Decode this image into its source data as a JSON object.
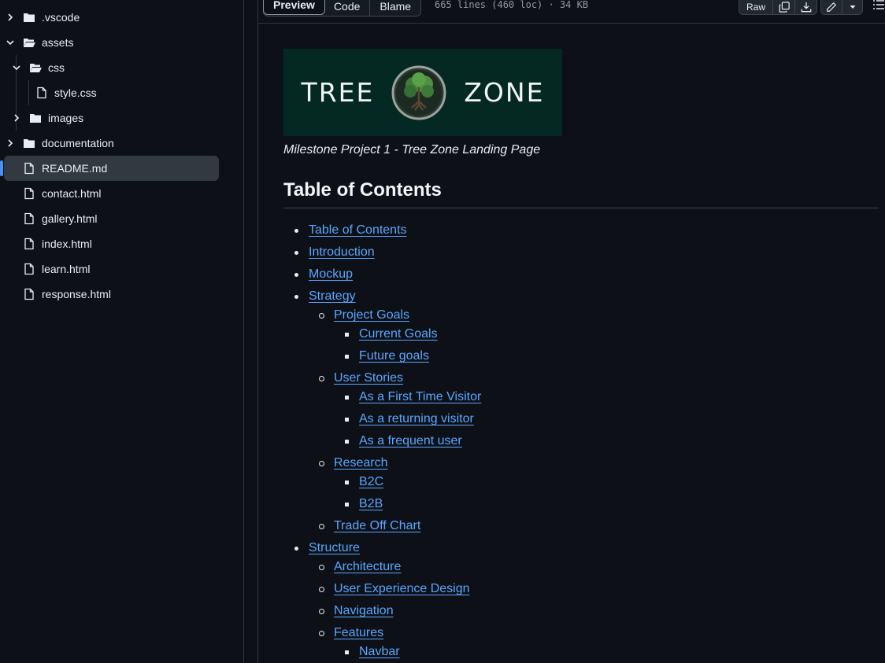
{
  "file_tree": [
    {
      "label": ".vscode",
      "type": "folder",
      "expanded": false,
      "depth": 0
    },
    {
      "label": "assets",
      "type": "folder",
      "expanded": true,
      "depth": 0
    },
    {
      "label": "css",
      "type": "folder",
      "expanded": true,
      "depth": 1
    },
    {
      "label": "style.css",
      "type": "file",
      "depth": 2
    },
    {
      "label": "images",
      "type": "folder",
      "expanded": false,
      "depth": 1
    },
    {
      "label": "documentation",
      "type": "folder",
      "expanded": false,
      "depth": 0
    },
    {
      "label": "README.md",
      "type": "file",
      "depth": 0,
      "selected": true
    },
    {
      "label": "contact.html",
      "type": "file",
      "depth": 0
    },
    {
      "label": "gallery.html",
      "type": "file",
      "depth": 0
    },
    {
      "label": "index.html",
      "type": "file",
      "depth": 0
    },
    {
      "label": "learn.html",
      "type": "file",
      "depth": 0
    },
    {
      "label": "response.html",
      "type": "file",
      "depth": 0
    }
  ],
  "toolbar": {
    "tabs": [
      "Preview",
      "Code",
      "Blame"
    ],
    "active_tab": "Preview",
    "file_info": "665 lines (460 loc) · 34 KB",
    "raw_label": "Raw",
    "icons": [
      "copy-icon",
      "download-icon",
      "pencil-icon",
      "triangle-down-icon",
      "list-unordered-icon"
    ]
  },
  "readme": {
    "banner": {
      "left_word": "TREE",
      "right_word": "ZONE"
    },
    "caption": "Milestone Project 1 - Tree Zone Landing Page",
    "toc_heading": "Table of Contents",
    "toc": [
      {
        "text": "Table of Contents",
        "level": 1
      },
      {
        "text": "Introduction",
        "level": 1
      },
      {
        "text": "Mockup",
        "level": 1
      },
      {
        "text": "Strategy",
        "level": 1
      },
      {
        "text": "Project Goals",
        "level": 2
      },
      {
        "text": "Current Goals",
        "level": 3
      },
      {
        "text": "Future goals",
        "level": 3
      },
      {
        "text": "User Stories",
        "level": 2
      },
      {
        "text": "As a First Time Visitor",
        "level": 3
      },
      {
        "text": "As a returning visitor",
        "level": 3
      },
      {
        "text": "As a frequent user",
        "level": 3
      },
      {
        "text": "Research",
        "level": 2
      },
      {
        "text": "B2C",
        "level": 3
      },
      {
        "text": "B2B",
        "level": 3
      },
      {
        "text": "Trade Off Chart",
        "level": 2
      },
      {
        "text": "Structure",
        "level": 1
      },
      {
        "text": "Architecture",
        "level": 2
      },
      {
        "text": "User Experience Design",
        "level": 2
      },
      {
        "text": "Navigation",
        "level": 2
      },
      {
        "text": "Features",
        "level": 2
      },
      {
        "text": "Navbar",
        "level": 3
      }
    ]
  },
  "colors": {
    "background": "#0d1117",
    "link": "#58a6ff",
    "border": "#30363d",
    "banner_bg": "#042923",
    "selection_accent": "#4493f8"
  }
}
